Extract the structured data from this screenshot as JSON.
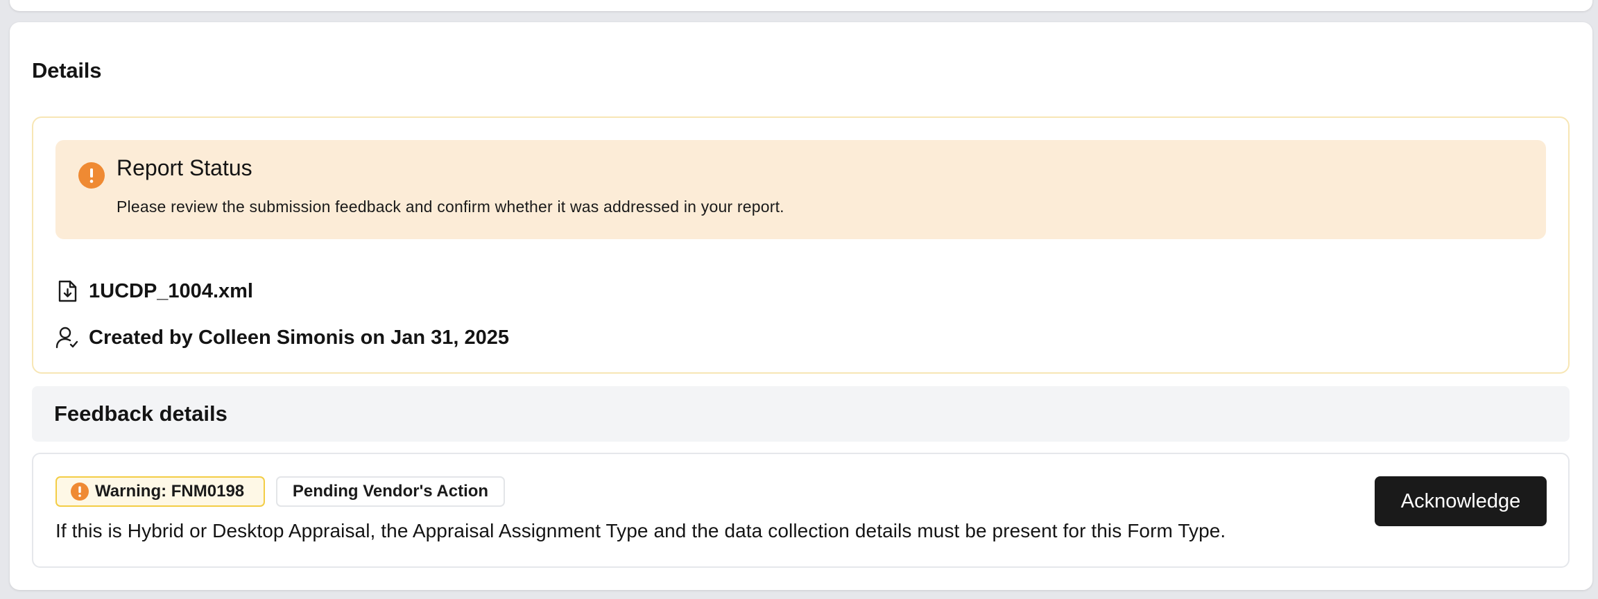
{
  "details": {
    "title": "Details",
    "report_status": {
      "title": "Report Status",
      "message": "Please review the submission feedback and confirm whether it was addressed in your report.",
      "icon": "exclamation-circle-icon",
      "accent_color": "#ef8a33",
      "background_color": "#fcecd7"
    },
    "file": {
      "icon": "file-download-icon",
      "name": "1UCDP_1004.xml"
    },
    "created": {
      "icon": "user-check-icon",
      "text": "Created by Colleen Simonis on Jan 31, 2025"
    }
  },
  "feedback": {
    "header": "Feedback details",
    "items": [
      {
        "warning_badge": "Warning: FNM0198",
        "warning_color": "#ef8a33",
        "status_badge": "Pending Vendor's Action",
        "message": "If this is Hybrid or Desktop Appraisal, the Appraisal Assignment Type and the data collection details must be present for this Form Type.",
        "action_label": "Acknowledge"
      }
    ]
  }
}
